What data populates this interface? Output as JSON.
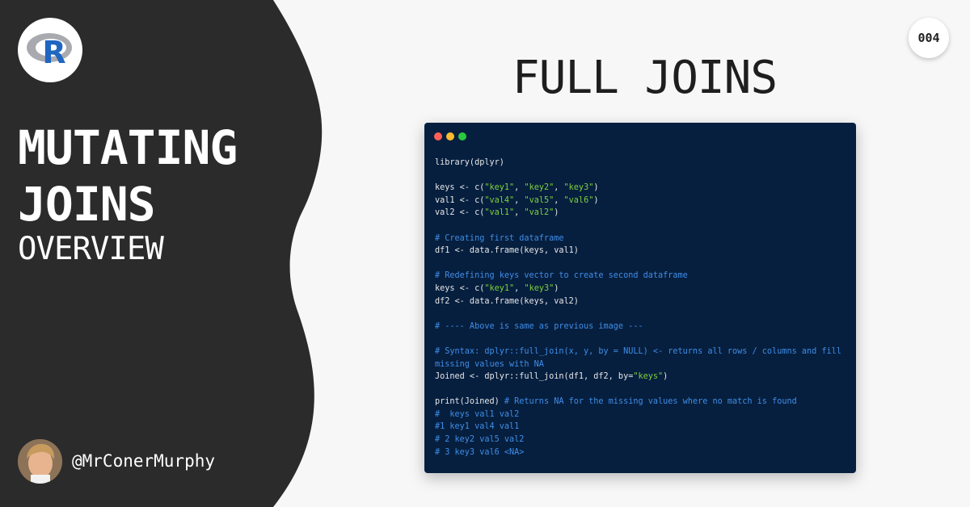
{
  "colors": {
    "side_panel": "#2b2b2b",
    "page_background": "#f7f7f7",
    "code_background": "#061f3f",
    "code_text": "#e6e6e6",
    "code_comment": "#3f8de6",
    "code_string": "#7fd13b",
    "dot_red": "#ff5f57",
    "dot_yellow": "#febc2e",
    "dot_green": "#28c840"
  },
  "sidebar": {
    "logo_icon": "r-language-logo",
    "logo_letter": "R",
    "title_line1": "MUTATING",
    "title_line2": "JOINS",
    "subtitle": "OVERVIEW",
    "author_handle": "@MrConerMurphy",
    "avatar_icon": "author-avatar"
  },
  "badge": {
    "number": "004"
  },
  "main": {
    "title": "FULL JOINS"
  },
  "code_window": {
    "window_controls": [
      "close-dot",
      "minimize-dot",
      "maximize-dot"
    ],
    "lines": [
      [
        {
          "t": "library(dplyr)",
          "c": "txt"
        }
      ],
      [],
      [
        {
          "t": "keys <- c(",
          "c": "txt"
        },
        {
          "t": "\"key1\"",
          "c": "str"
        },
        {
          "t": ", ",
          "c": "txt"
        },
        {
          "t": "\"key2\"",
          "c": "str"
        },
        {
          "t": ", ",
          "c": "txt"
        },
        {
          "t": "\"key3\"",
          "c": "str"
        },
        {
          "t": ")",
          "c": "txt"
        }
      ],
      [
        {
          "t": "val1 <- c(",
          "c": "txt"
        },
        {
          "t": "\"val4\"",
          "c": "str"
        },
        {
          "t": ", ",
          "c": "txt"
        },
        {
          "t": "\"val5\"",
          "c": "str"
        },
        {
          "t": ", ",
          "c": "txt"
        },
        {
          "t": "\"val6\"",
          "c": "str"
        },
        {
          "t": ")",
          "c": "txt"
        }
      ],
      [
        {
          "t": "val2 <- c(",
          "c": "txt"
        },
        {
          "t": "\"val1\"",
          "c": "str"
        },
        {
          "t": ", ",
          "c": "txt"
        },
        {
          "t": "\"val2\"",
          "c": "str"
        },
        {
          "t": ")",
          "c": "txt"
        }
      ],
      [],
      [
        {
          "t": "# Creating first dataframe",
          "c": "com"
        }
      ],
      [
        {
          "t": "df1 <- data.frame(keys, val1)",
          "c": "txt"
        }
      ],
      [],
      [
        {
          "t": "# Redefining keys vector to create second dataframe",
          "c": "com"
        }
      ],
      [
        {
          "t": "keys <- c(",
          "c": "txt"
        },
        {
          "t": "\"key1\"",
          "c": "str"
        },
        {
          "t": ", ",
          "c": "txt"
        },
        {
          "t": "\"key3\"",
          "c": "str"
        },
        {
          "t": ")",
          "c": "txt"
        }
      ],
      [
        {
          "t": "df2 <- data.frame(keys, val2)",
          "c": "txt"
        }
      ],
      [],
      [
        {
          "t": "# ---- Above is same as previous image ---",
          "c": "com"
        }
      ],
      [],
      [
        {
          "t": "# Syntax: dplyr::full_join(x, y, by = NULL) <- returns all rows / columns and fill",
          "c": "com"
        }
      ],
      [
        {
          "t": "missing values with NA",
          "c": "com"
        }
      ],
      [
        {
          "t": "Joined <- dplyr::full_join(df1, df2, by=",
          "c": "txt"
        },
        {
          "t": "\"keys\"",
          "c": "str"
        },
        {
          "t": ")",
          "c": "txt"
        }
      ],
      [],
      [
        {
          "t": "print(Joined) ",
          "c": "txt"
        },
        {
          "t": "# Returns NA for the missing values where no match is found",
          "c": "com"
        }
      ],
      [
        {
          "t": "#  keys val1 val2",
          "c": "com"
        }
      ],
      [
        {
          "t": "#1 key1 val4 val1",
          "c": "com"
        }
      ],
      [
        {
          "t": "# 2 key2 val5 val2",
          "c": "com"
        }
      ],
      [
        {
          "t": "# 3 key3 val6 <NA>",
          "c": "com"
        }
      ]
    ]
  }
}
